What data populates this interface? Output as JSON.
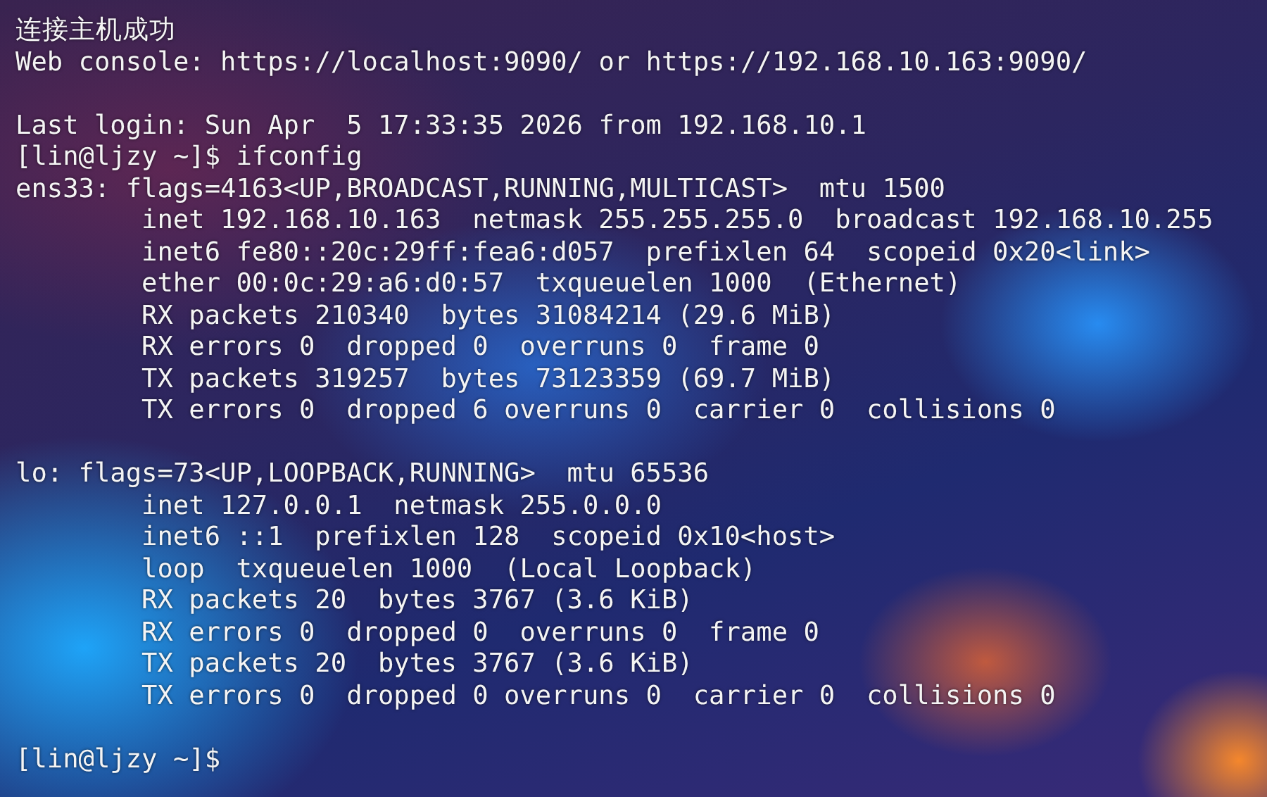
{
  "terminal": {
    "blocks": [
      {
        "lines": [
          {
            "text": "连接主机成功"
          },
          {
            "text": "Web console: https://localhost:9090/ or https://192.168.10.163:9090/"
          }
        ]
      },
      {
        "lines": [
          {
            "text": "Last login: Sun Apr  5 17:33:35 2026 from 192.168.10.1"
          },
          {
            "text": "[lin@ljzy ~]$ ifconfig"
          },
          {
            "text": "ens33: flags=4163<UP,BROADCAST,RUNNING,MULTICAST>  mtu 1500",
            "children": [
              {
                "text": "inet 192.168.10.163  netmask 255.255.255.0  broadcast 192.168.10.255"
              },
              {
                "text": "inet6 fe80::20c:29ff:fea6:d057  prefixlen 64  scopeid 0x20<link>"
              },
              {
                "text": "ether 00:0c:29:a6:d0:57  txqueuelen 1000  (Ethernet)"
              },
              {
                "text": "RX packets 210340  bytes 31084214 (29.6 MiB)"
              },
              {
                "text": "RX errors 0  dropped 0  overruns 0  frame 0"
              },
              {
                "text": "TX packets 319257  bytes 73123359 (69.7 MiB)"
              },
              {
                "text": "TX errors 0  dropped 6 overruns 0  carrier 0  collisions 0"
              }
            ]
          }
        ]
      },
      {
        "lines": [
          {
            "text": "lo: flags=73<UP,LOOPBACK,RUNNING>  mtu 65536",
            "children": [
              {
                "text": "inet 127.0.0.1  netmask 255.0.0.0"
              },
              {
                "text": "inet6 ::1  prefixlen 128  scopeid 0x10<host>"
              },
              {
                "text": "loop  txqueuelen 1000  (Local Loopback)"
              },
              {
                "text": "RX packets 20  bytes 3767 (3.6 KiB)"
              },
              {
                "text": "RX errors 0  dropped 0  overruns 0  frame 0"
              },
              {
                "text": "TX packets 20  bytes 3767 (3.6 KiB)"
              },
              {
                "text": "TX errors 0  dropped 0 overruns 0  carrier 0  collisions 0"
              }
            ]
          }
        ]
      },
      {
        "lines": [
          {
            "text": "[lin@ljzy ~]$"
          }
        ]
      }
    ]
  }
}
